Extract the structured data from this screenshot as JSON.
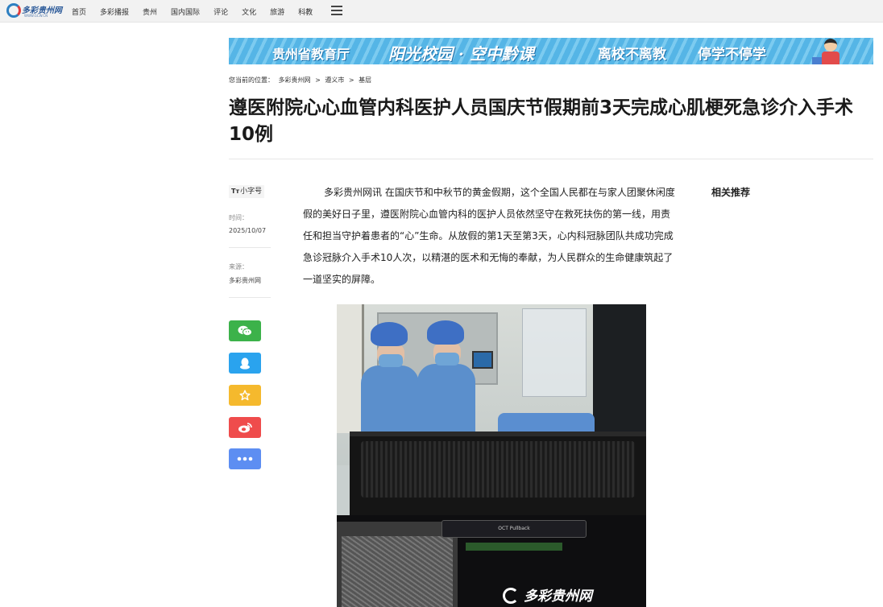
{
  "logo": {
    "text": "多彩贵州网",
    "url": "WWW.GCW.CN"
  },
  "nav": {
    "items": [
      "首页",
      "多彩播报",
      "贵州",
      "国内国际",
      "评论",
      "文化",
      "旅游",
      "科教"
    ],
    "menu_icon": "hamburger-menu-icon"
  },
  "banner": {
    "segments": [
      "贵州省教育厅",
      "阳光校园 · 空中黔课",
      "离校不离教",
      "停学不停学"
    ]
  },
  "breadcrumb": {
    "label": "您当前的位置：",
    "items": [
      "多彩贵州网",
      ">",
      "遵义市",
      ">",
      "基层"
    ]
  },
  "article": {
    "title": "遵医附院心心血管内科医护人员国庆节假期前3天完成心肌梗死急诊介入手术10例",
    "font_size_toggle": "小字号",
    "font_size_icon": "Tт",
    "time_label": "时间：",
    "time_value": "2025/10/07",
    "source_label": "来源：",
    "source_value": "多彩贵州网",
    "body": "多彩贵州网讯 在国庆节和中秋节的黄金假期，这个全国人民都在与家人团聚休闲度假的美好日子里，遵医附院心血管内科的医护人员依然坚守在救死扶伤的第一线，用责任和担当守护着患者的“心”生命。从放假的第1天至第3天，心内科冠脉团队共成功完成急诊冠脉介入手术10人次，以精湛的医术和无悔的奉献，为人民群众的生命健康筑起了一道坚实的屏障。"
  },
  "share": [
    {
      "name": "wechat",
      "icon": "wechat-icon",
      "color": "#3cb24a"
    },
    {
      "name": "qq",
      "icon": "qq-icon",
      "color": "#2aa3ee"
    },
    {
      "name": "qzone",
      "icon": "star-icon",
      "color": "#f5b92d"
    },
    {
      "name": "weibo",
      "icon": "weibo-icon",
      "color": "#ef4c4c"
    },
    {
      "name": "more",
      "icon": "more-dots-icon",
      "color": "#5d8ef2"
    }
  ],
  "sidebar": {
    "related_title": "相关推荐"
  },
  "photo": {
    "watermark": "多彩贵州网",
    "screen_label": "OCT Pullback"
  }
}
